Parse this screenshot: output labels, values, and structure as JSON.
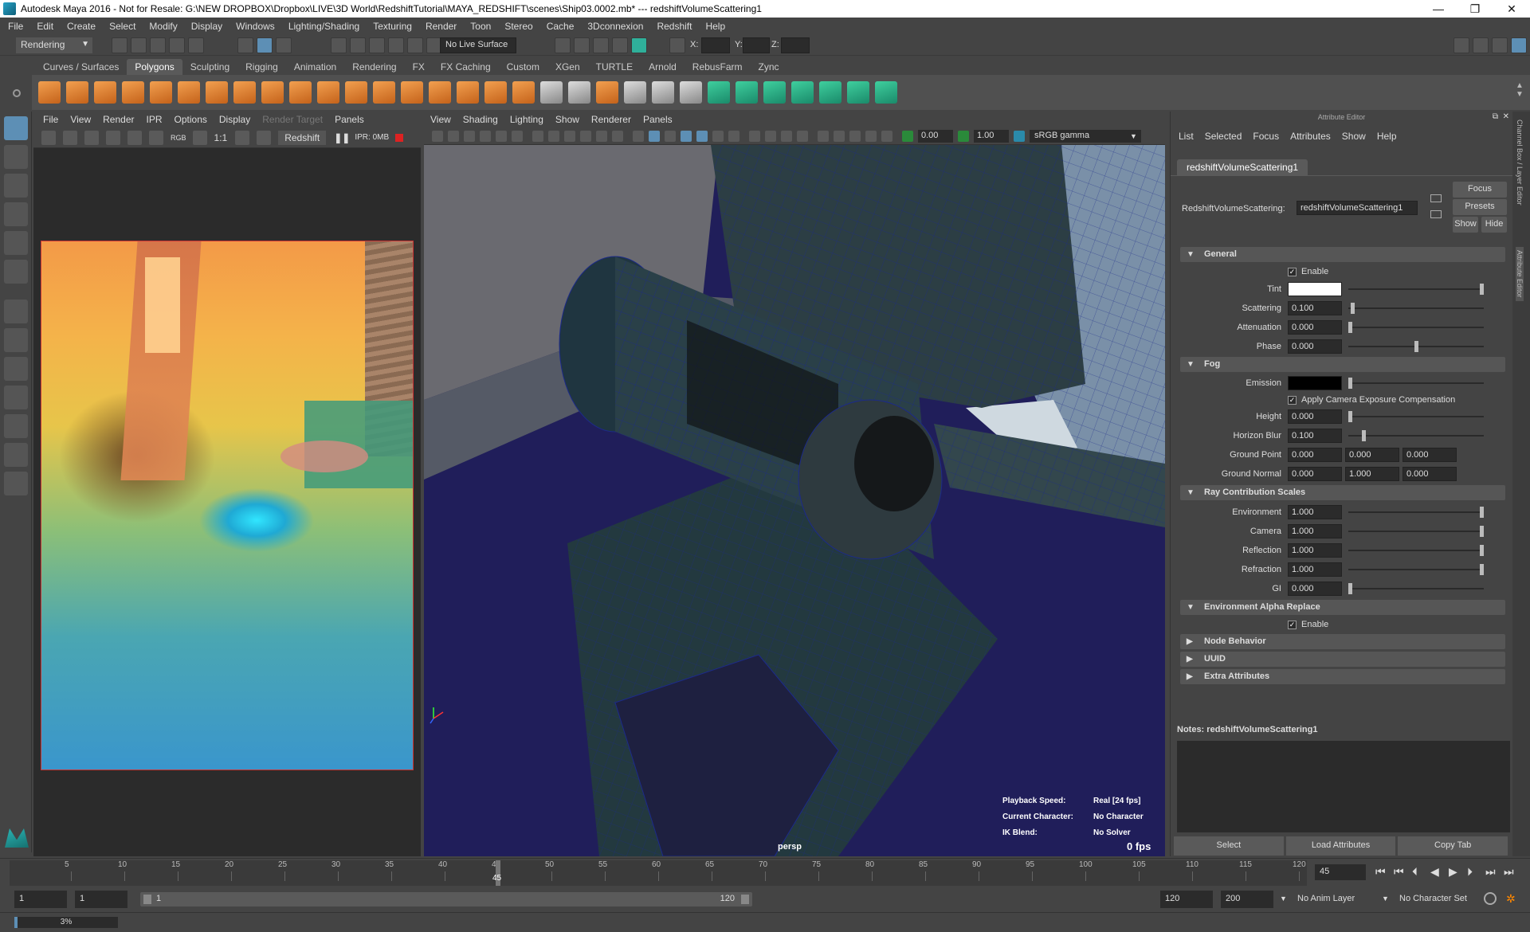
{
  "window": {
    "title": "Autodesk Maya 2016 - Not for Resale: G:\\NEW DROPBOX\\Dropbox\\LIVE\\3D World\\RedshiftTutorial\\MAYA_REDSHIFT\\scenes\\Ship03.0002.mb*   ---   redshiftVolumeScattering1",
    "minimize": "—",
    "restore": "❐",
    "close": "✕"
  },
  "menubar": [
    "File",
    "Edit",
    "Create",
    "Select",
    "Modify",
    "Display",
    "Windows",
    "Lighting/Shading",
    "Texturing",
    "Render",
    "Toon",
    "Stereo",
    "Cache",
    "3Dconnexion",
    "Redshift",
    "Help"
  ],
  "statusline": {
    "mode": "Rendering",
    "live_surface": "No Live Surface",
    "x_label": "X:",
    "y_label": "Y:",
    "z_label": "Z:"
  },
  "shelf_tabs": [
    "Curves / Surfaces",
    "Polygons",
    "Sculpting",
    "Rigging",
    "Animation",
    "Rendering",
    "FX",
    "FX Caching",
    "Custom",
    "XGen",
    "TURTLE",
    "Arnold",
    "RebusFarm",
    "Zync"
  ],
  "shelf_active": "Polygons",
  "render_view": {
    "menu": [
      "File",
      "View",
      "Render",
      "IPR",
      "Options",
      "Display"
    ],
    "menu_disabled": "Render Target",
    "menu_last": "Panels",
    "ratio": "1:1",
    "renderer": "Redshift",
    "rgb": "RGB",
    "ipr": "IPR: 0MB"
  },
  "viewport": {
    "menu": [
      "View",
      "Shading",
      "Lighting",
      "Show",
      "Renderer",
      "Panels"
    ],
    "exposure": "0.00",
    "gamma": "1.00",
    "color_space": "sRGB gamma",
    "camera": "persp",
    "fps": "0 fps",
    "hud": {
      "playback_label": "Playback Speed:",
      "playback_value": "Real [24 fps]",
      "character_label": "Current Character:",
      "character_value": "No Character",
      "ik_label": "IK Blend:",
      "ik_value": "No Solver"
    }
  },
  "attribute_editor": {
    "panel_title": "Attribute Editor",
    "menu": [
      "List",
      "Selected",
      "Focus",
      "Attributes",
      "Show",
      "Help"
    ],
    "tab": "redshiftVolumeScattering1",
    "node_label": "RedshiftVolumeScattering:",
    "node_name": "redshiftVolumeScattering1",
    "btn_focus": "Focus",
    "btn_presets": "Presets",
    "btn_show": "Show",
    "btn_hide": "Hide",
    "sections": {
      "general": "General",
      "fog": "Fog",
      "ray": "Ray Contribution Scales",
      "env_alpha": "Environment Alpha Replace",
      "node_behavior": "Node Behavior",
      "uuid": "UUID",
      "extra": "Extra Attributes"
    },
    "enable_label": "Enable",
    "check_mark": "✓",
    "tint_label": "Tint",
    "tint_color": "#ffffff",
    "scattering": {
      "label": "Scattering",
      "value": "0.100",
      "level": 0.02
    },
    "attenuation": {
      "label": "Attenuation",
      "value": "0.000",
      "level": 0.0
    },
    "phase": {
      "label": "Phase",
      "value": "0.000",
      "level": 0.5
    },
    "emission_label": "Emission",
    "emission_color": "#000000",
    "apply_exposure": "Apply Camera Exposure Compensation",
    "height": {
      "label": "Height",
      "value": "0.000",
      "level": 0.0
    },
    "horizon_blur": {
      "label": "Horizon Blur",
      "value": "0.100",
      "level": 0.1
    },
    "ground_point": {
      "label": "Ground Point",
      "values": [
        "0.000",
        "0.000",
        "0.000"
      ]
    },
    "ground_normal": {
      "label": "Ground Normal",
      "values": [
        "0.000",
        "1.000",
        "0.000"
      ]
    },
    "environment": {
      "label": "Environment",
      "value": "1.000",
      "level": 1.0
    },
    "camera": {
      "label": "Camera",
      "value": "1.000",
      "level": 1.0
    },
    "reflection": {
      "label": "Reflection",
      "value": "1.000",
      "level": 1.0
    },
    "refraction": {
      "label": "Refraction",
      "value": "1.000",
      "level": 1.0
    },
    "gi": {
      "label": "GI",
      "value": "0.000",
      "level": 0.0
    },
    "notes_label": "Notes:",
    "notes_node": "redshiftVolumeScattering1",
    "bottom_buttons": [
      "Select",
      "Load Attributes",
      "Copy Tab"
    ],
    "side_tabs": [
      "Channel Box / Layer Editor",
      "Attribute Editor"
    ]
  },
  "time_slider": {
    "ticks": [
      "5",
      "10",
      "15",
      "20",
      "25",
      "30",
      "35",
      "40",
      "45",
      "50",
      "55",
      "60",
      "65",
      "70",
      "75",
      "80",
      "85",
      "90",
      "95",
      "100",
      "105",
      "110",
      "115",
      "120"
    ],
    "current_frame": "45",
    "playhead_frame": "45",
    "start": 0,
    "end": 120,
    "controls": [
      "⏮",
      "⏮",
      "⏴",
      "◀",
      "▶",
      "⏵",
      "⏭",
      "⏭"
    ]
  },
  "range_slider": {
    "start": "1",
    "inner_start": "1",
    "bar_start": "1",
    "bar_end": "120",
    "end": "120",
    "outer_end": "200",
    "anim_layer": "No Anim Layer",
    "character_set": "No Character Set"
  },
  "command_line": {
    "progress": "3%",
    "progress_level": 0.03
  }
}
